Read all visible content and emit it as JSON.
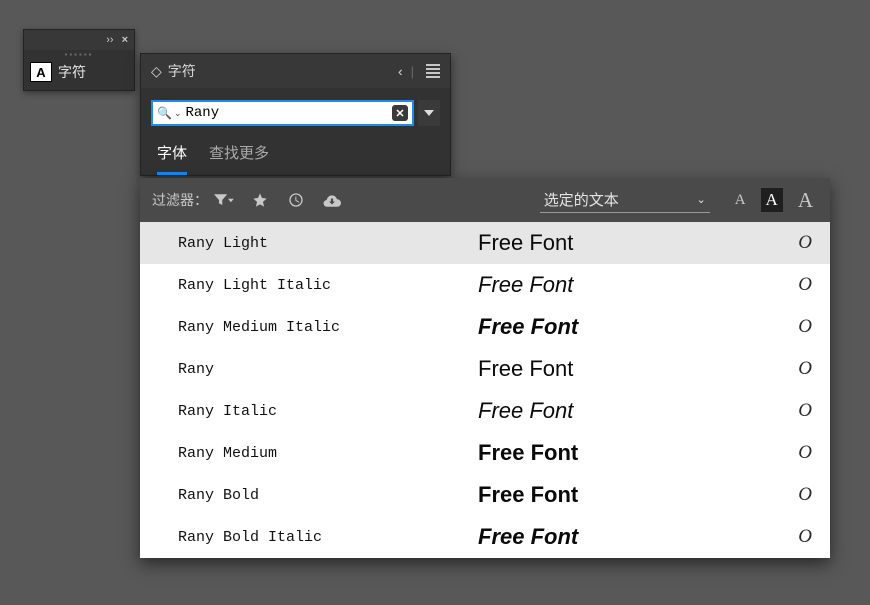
{
  "dock": {
    "collapse_glyph": "››",
    "close_glyph": "×",
    "item_icon_letter": "A",
    "item_label": "字符"
  },
  "panel": {
    "title_glyph": "◇",
    "title": "字符",
    "collapse_glyph": "‹‹",
    "search": {
      "icon": "🔍",
      "chev": "⌄",
      "value": "Rany",
      "clear": "✕"
    },
    "tabs": [
      {
        "label": "字体",
        "active": true
      },
      {
        "label": "查找更多",
        "active": false
      }
    ]
  },
  "filterbar": {
    "label": "过滤器：",
    "size_selected": "选定的文本"
  },
  "fonts": [
    {
      "name": "Rany Light",
      "preview": "Free Font",
      "class": "light",
      "badge": "O",
      "selected": true
    },
    {
      "name": "Rany Light Italic",
      "preview": "Free Font",
      "class": "lightitalic",
      "badge": "O",
      "selected": false
    },
    {
      "name": "Rany Medium Italic",
      "preview": "Free Font",
      "class": "meditalic",
      "badge": "O",
      "selected": false
    },
    {
      "name": "Rany",
      "preview": "Free Font",
      "class": "reg",
      "badge": "O",
      "selected": false
    },
    {
      "name": "Rany Italic",
      "preview": "Free Font",
      "class": "italic",
      "badge": "O",
      "selected": false
    },
    {
      "name": "Rany Medium",
      "preview": "Free Font",
      "class": "med",
      "badge": "O",
      "selected": false
    },
    {
      "name": "Rany Bold",
      "preview": "Free Font",
      "class": "bold",
      "badge": "O",
      "selected": false
    },
    {
      "name": "Rany Bold Italic",
      "preview": "Free Font",
      "class": "bolditalic",
      "badge": "O",
      "selected": false
    }
  ]
}
